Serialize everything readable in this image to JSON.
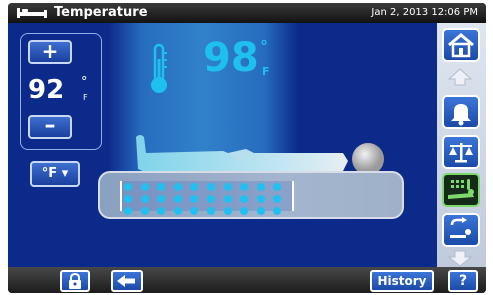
{
  "titlebar": {
    "title": "Temperature",
    "datetime": "Jan 2, 2013 12:06 PM",
    "icon": "bed-icon"
  },
  "setpoint": {
    "increase_label": "+",
    "decrease_label": "–",
    "value": "92",
    "degree": "°",
    "unit": "F"
  },
  "unit_select": {
    "label": "°F ▾"
  },
  "patient_temp": {
    "value": "98",
    "degree": "°",
    "unit": "F",
    "icon": "thermometer-icon"
  },
  "mattress": {
    "active_dot_rows": 3,
    "active_dot_cols": 10
  },
  "right_nav": {
    "items": [
      "home-icon",
      "scroll-up-arrow-icon",
      "bell-icon",
      "scale-icon",
      "heat-therapy-icon",
      "turn-assist-icon",
      "scroll-down-arrow-icon"
    ],
    "selected": "heat-therapy-icon"
  },
  "bottombar": {
    "history_label": "History",
    "help_label": "?",
    "lock_icon": "lock-icon",
    "back_icon": "back-arrow-icon"
  },
  "colors": {
    "background": "#0c2a8a",
    "accent": "#1ec0f0",
    "button": "#2a5ec0",
    "selected_border": "#7ed96c"
  }
}
